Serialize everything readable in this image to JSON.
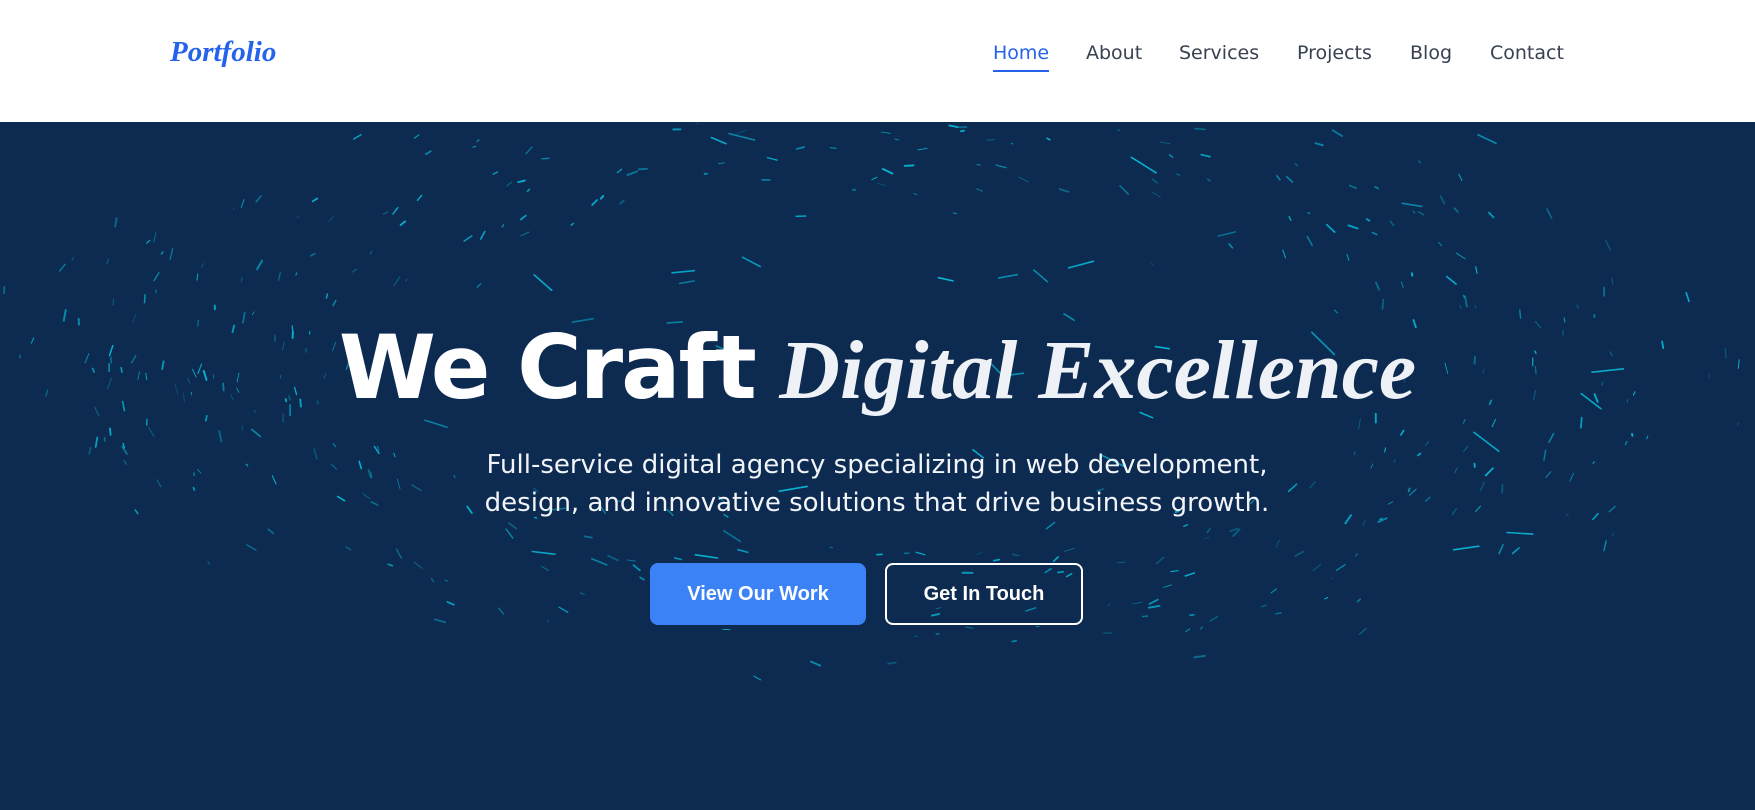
{
  "brand": {
    "logo_text": "Portfolio",
    "accent_color": "#2563eb"
  },
  "nav": {
    "active": "Home",
    "items": [
      {
        "label": "Home"
      },
      {
        "label": "About"
      },
      {
        "label": "Services"
      },
      {
        "label": "Projects"
      },
      {
        "label": "Blog"
      },
      {
        "label": "Contact"
      }
    ]
  },
  "hero": {
    "background_color": "#0d2a50",
    "particle_color": "#06b6d4",
    "title_plain": "We Craft",
    "title_accent": "Digital Excellence",
    "subtitle_line1": "Full-service digital agency specializing in web development,",
    "subtitle_line2": "design, and innovative solutions that drive business growth.",
    "primary_button": {
      "label": "View Our Work",
      "color": "#3b82f6"
    },
    "secondary_button": {
      "label": "Get In Touch"
    }
  }
}
